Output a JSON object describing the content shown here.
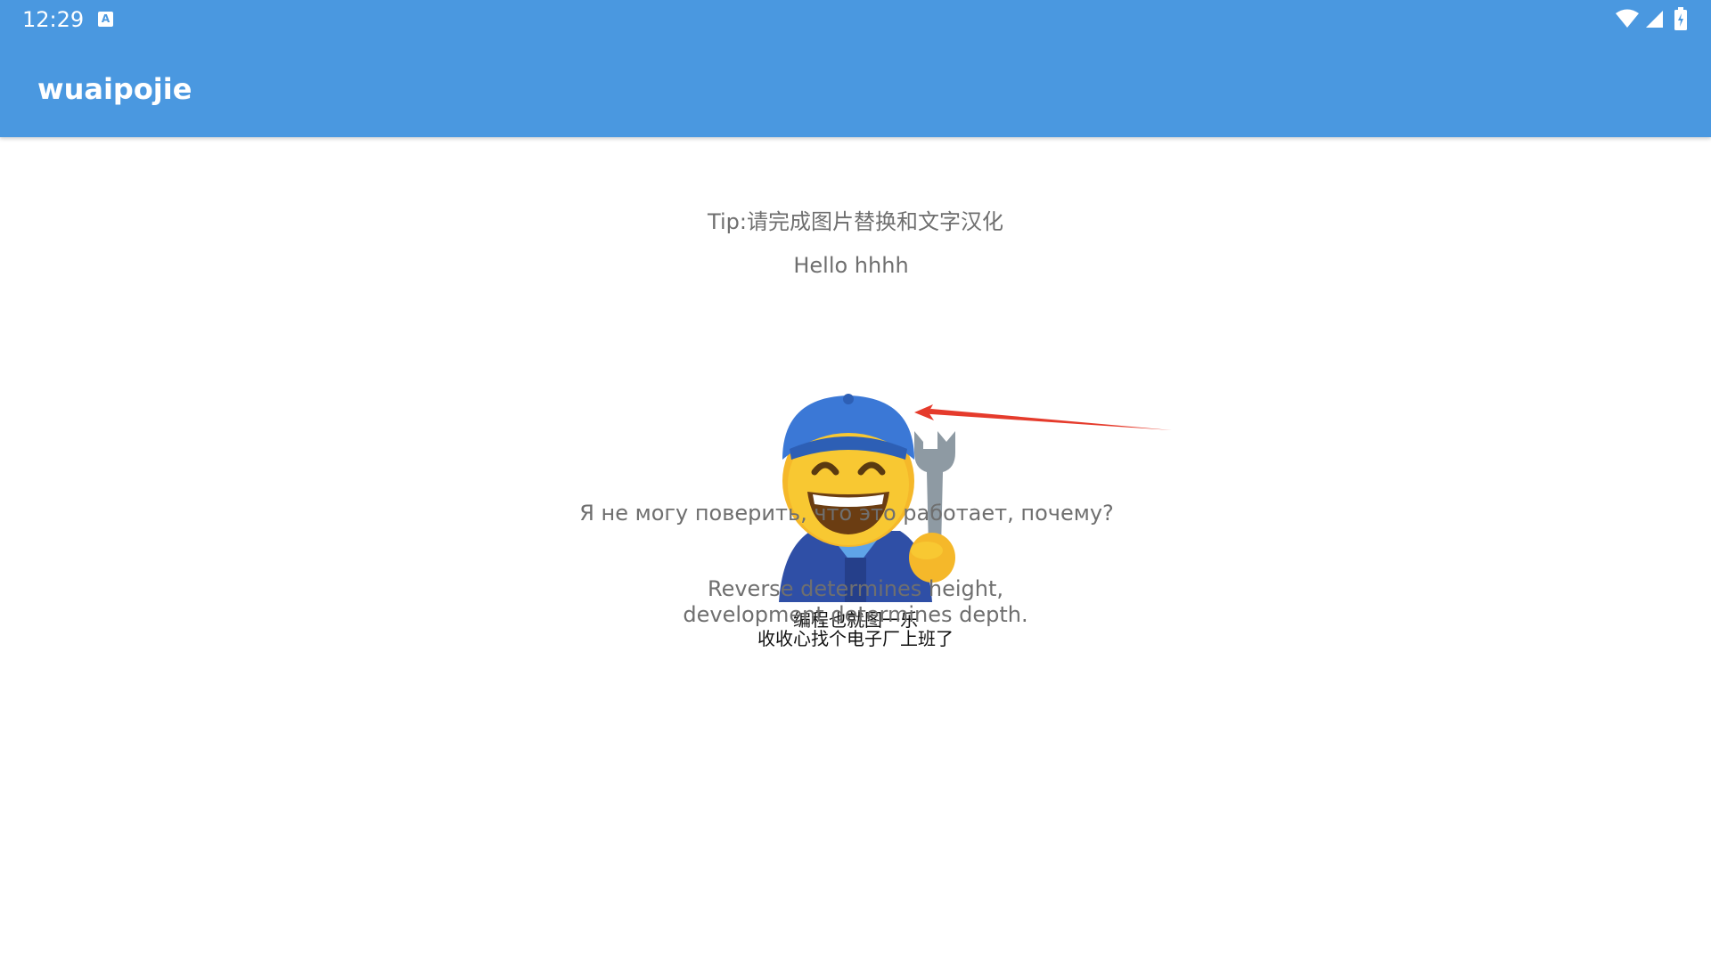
{
  "status_bar": {
    "time": "12:29",
    "notification_icon": "A",
    "icons": [
      "wifi-icon",
      "cellular-signal-icon",
      "battery-charging-icon"
    ]
  },
  "app_bar": {
    "title": "wuaipojie",
    "background_color": "#4a98e0"
  },
  "content": {
    "tip": "Tip:请完成图片替换和文字汉化",
    "hello": "Hello hhhh",
    "annotation_arrow_color": "#e53b2c",
    "meme": {
      "caption_line1": "编程也就图一乐",
      "caption_line2": "收收心找个电子厂上班了"
    },
    "russian": "Я не могу поверить, что это работает, почему?",
    "reverse_line1": "Reverse determines height,",
    "reverse_line2": "development determines depth."
  }
}
